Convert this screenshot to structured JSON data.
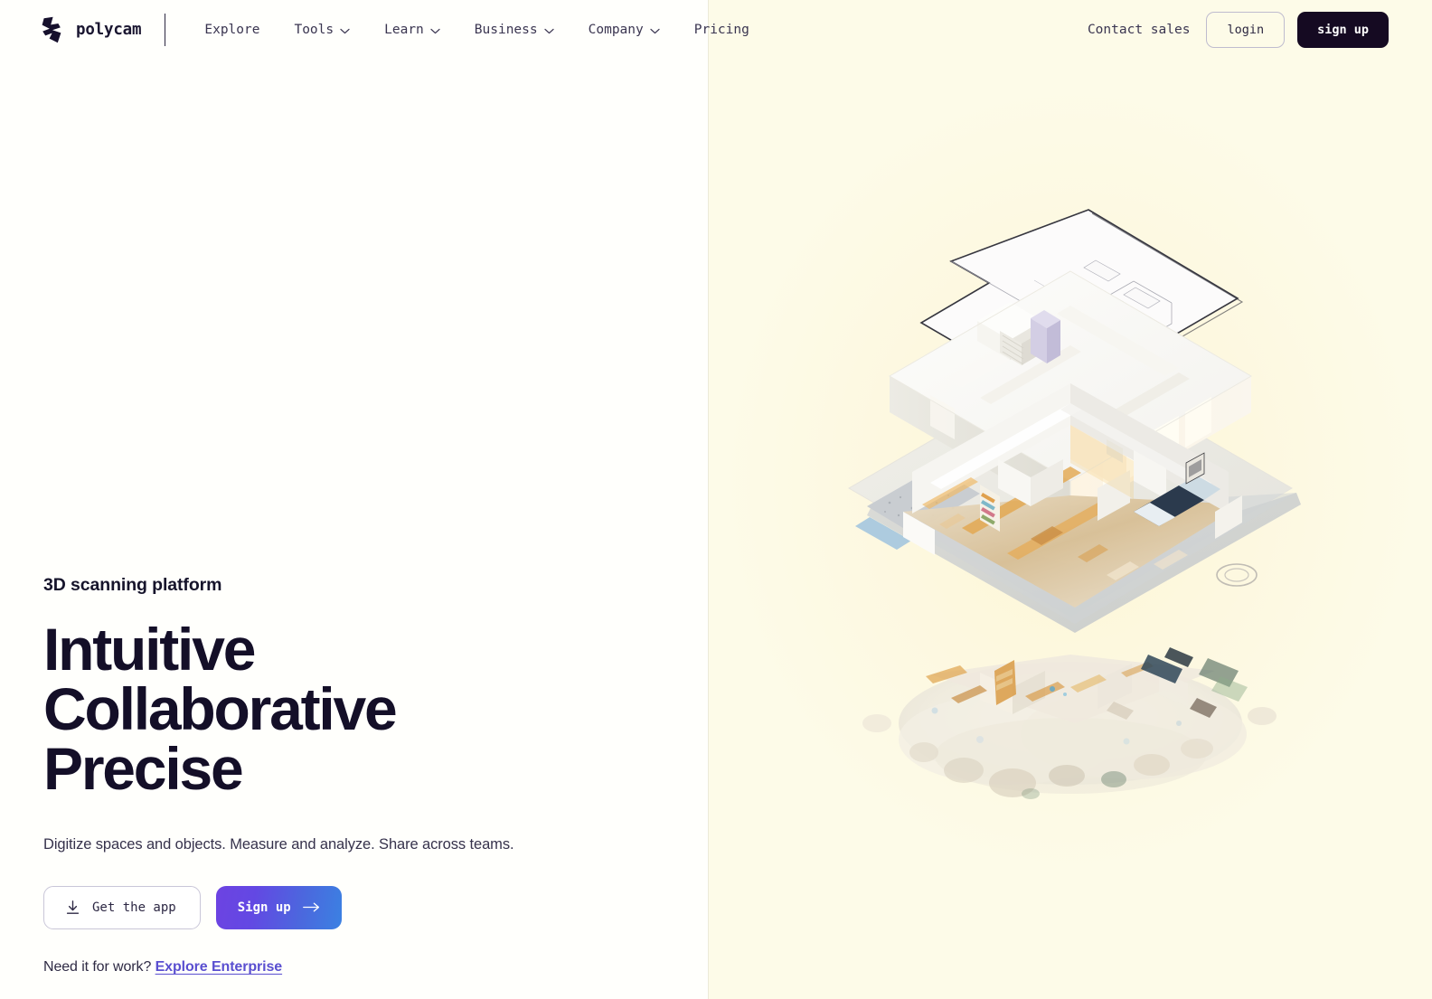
{
  "brand": {
    "name": "polycam",
    "logo_icon": "polycam-lightning-r-logo"
  },
  "nav": {
    "items": [
      {
        "label": "Explore",
        "has_dropdown": false,
        "icon": ""
      },
      {
        "label": "Tools",
        "has_dropdown": true,
        "icon": "chevron-down-icon"
      },
      {
        "label": "Learn",
        "has_dropdown": true,
        "icon": "chevron-down-icon"
      },
      {
        "label": "Business",
        "has_dropdown": true,
        "icon": "chevron-down-icon"
      },
      {
        "label": "Company",
        "has_dropdown": true,
        "icon": "chevron-down-icon"
      },
      {
        "label": "Pricing",
        "has_dropdown": false,
        "icon": ""
      }
    ],
    "contact_sales": "Contact sales",
    "login": "login",
    "signup": "sign up"
  },
  "hero": {
    "eyebrow": "3D scanning platform",
    "headline_lines": [
      "Intuitive",
      "Collaborative",
      "Precise"
    ],
    "subhead": "Digitize spaces and objects. Measure and analyze. Share across teams.",
    "get_app_label": "Get the app",
    "get_app_icon": "download-icon",
    "signup_label": "Sign up",
    "signup_icon": "arrow-right-icon",
    "enterprise_prefix": "Need it for work?",
    "enterprise_link": "Explore Enterprise"
  },
  "illustration": {
    "alt": "Exploded isometric view of a 3D house scan",
    "layers": [
      {
        "name": "floor-plan-layer",
        "description": "2D architectural floor plan outline"
      },
      {
        "name": "white-model-layer",
        "description": "Untextured white 3D mesh of rooms and walls"
      },
      {
        "name": "textured-mesh-layer",
        "description": "Photo-textured 3D mesh with furniture"
      },
      {
        "name": "point-cloud-layer",
        "description": "Raw colored point cloud of the scanned space"
      }
    ]
  },
  "colors": {
    "accent_purple": "#6d43e2",
    "accent_blue": "#3b81e2",
    "link_purple": "#5a4fd0",
    "ink": "#140f28",
    "panel_left_bg": "#fffffc",
    "panel_right_bg": "#fdfbe8",
    "divider": "#ecead8",
    "signup_nav_bg": "#150a22"
  }
}
